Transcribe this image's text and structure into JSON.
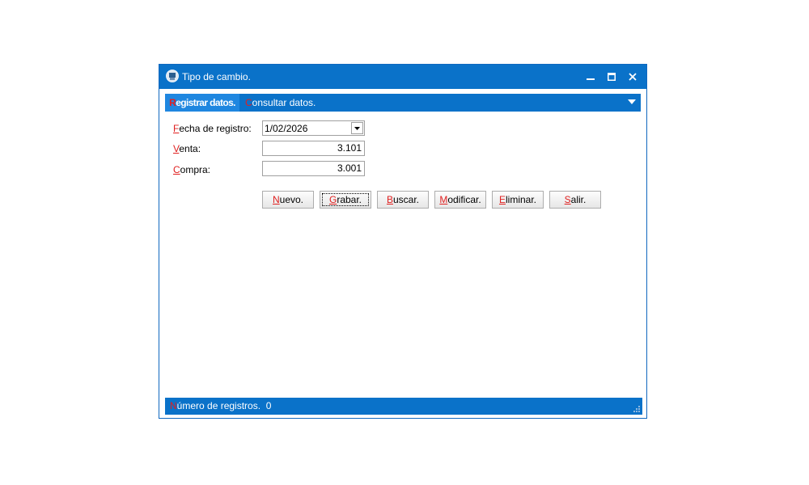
{
  "window": {
    "title": "Tipo de cambio.",
    "colors": {
      "titlebar": "#0a72c9",
      "active_tab": "#1f87e0",
      "mnemonic": "#e02020"
    }
  },
  "tabs": [
    {
      "mnemonic": "R",
      "rest": "egistrar datos.",
      "active": true
    },
    {
      "mnemonic": "C",
      "rest": "onsultar datos.",
      "active": false
    }
  ],
  "form": {
    "fecha": {
      "mnemonic": "F",
      "rest": "echa de registro:",
      "value": "1/02/2026"
    },
    "venta": {
      "mnemonic": "V",
      "rest": "enta:",
      "value": "3.101"
    },
    "compra": {
      "mnemonic": "C",
      "rest": "ompra:",
      "value": "3.001"
    }
  },
  "buttons": [
    {
      "mnemonic": "N",
      "rest": "uevo."
    },
    {
      "mnemonic": "G",
      "rest": "rabar."
    },
    {
      "mnemonic": "B",
      "rest": "uscar."
    },
    {
      "mnemonic": "M",
      "rest": "odificar."
    },
    {
      "mnemonic": "E",
      "rest": "liminar."
    },
    {
      "mnemonic": "S",
      "rest": "alir."
    }
  ],
  "status": {
    "mnemonic": "N",
    "rest": "úmero de registros.",
    "count": "0"
  },
  "icons": {
    "app": "money-icon",
    "minimize": "minimize-icon",
    "maximize": "maximize-icon",
    "close": "close-icon",
    "tab_menu": "chevron-down-icon",
    "date_drop": "dropdown-arrow-icon",
    "grip": "resize-grip-icon"
  }
}
